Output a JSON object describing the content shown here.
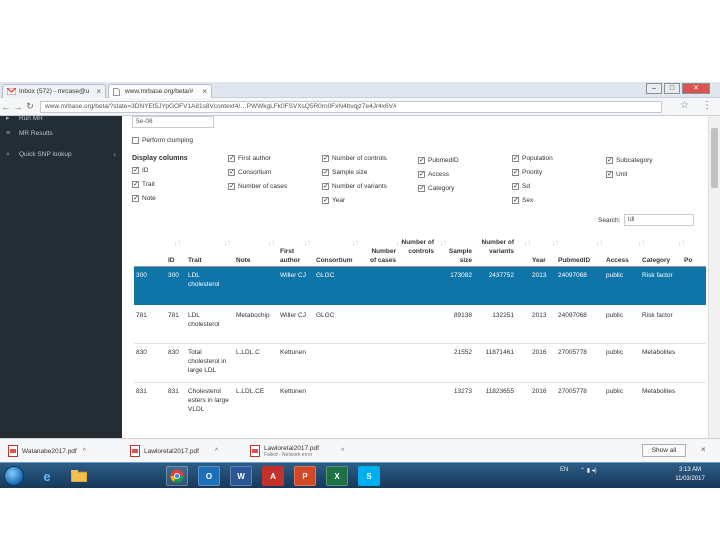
{
  "browser": {
    "tabs": [
      {
        "label": "Inbox (572) - mrcase@u"
      },
      {
        "label": "www.mrbase.org/beta/#"
      }
    ],
    "url": "www.mrbase.org/beta/?state=3DNYEt5JYpGOFV1A81s8Vcontext4/…PWWkgLFk0FSVXsQ5R0rn0FxN4bvqjz7e4Jr4x6V#"
  },
  "sidebar": {
    "items": [
      {
        "label": "Run MR",
        "icon": "play-icon"
      },
      {
        "label": "MR Results",
        "icon": "list-icon"
      },
      {
        "label": "Quick SNP lookup",
        "icon": "search-icon"
      }
    ]
  },
  "controls": {
    "pval_value": "5e-08",
    "clumping_label": "Perform clumping",
    "display_columns_label": "Display columns",
    "columns": [
      {
        "label": "ID",
        "checked": true
      },
      {
        "label": "Trait",
        "checked": true
      },
      {
        "label": "Note",
        "checked": true
      },
      {
        "label": "First author",
        "checked": true
      },
      {
        "label": "Consortium",
        "checked": true
      },
      {
        "label": "Number of cases",
        "checked": true
      },
      {
        "label": "Number of controls",
        "checked": true
      },
      {
        "label": "Sample size",
        "checked": true
      },
      {
        "label": "Number of variants",
        "checked": true
      },
      {
        "label": "Year",
        "checked": true
      },
      {
        "label": "PubmedID",
        "checked": true
      },
      {
        "label": "Access",
        "checked": true
      },
      {
        "label": "Category",
        "checked": true
      },
      {
        "label": "Population",
        "checked": true
      },
      {
        "label": "Priority",
        "checked": true
      },
      {
        "label": "Sd",
        "checked": true
      },
      {
        "label": "Sex",
        "checked": true
      },
      {
        "label": "Subcategory",
        "checked": true
      },
      {
        "label": "Unit",
        "checked": true
      }
    ],
    "search_label": "Search:",
    "search_value": "ldl"
  },
  "table": {
    "headers": [
      "ID",
      "Trait",
      "Note",
      "First author",
      "Consortium",
      "Number of cases",
      "Number of controls",
      "Sample size",
      "Number of variants",
      "Year",
      "PubmedID",
      "Access",
      "Category",
      "Po"
    ],
    "rows": [
      {
        "rownum": "300",
        "id": "300",
        "trait": "LDL cholesterol",
        "note": "",
        "author": "Willer CJ",
        "consortium": "GLGC",
        "cases": "",
        "controls": "",
        "size": "173082",
        "variants": "2437752",
        "year": "2013",
        "pubmed": "24097068",
        "access": "public",
        "category": "Risk factor",
        "selected": true
      },
      {
        "rownum": "781",
        "id": "781",
        "trait": "LDL cholesterol",
        "note": "Metabochip",
        "author": "Willer CJ",
        "consortium": "GLGC",
        "cases": "",
        "controls": "",
        "size": "89138",
        "variants": "132251",
        "year": "2013",
        "pubmed": "24097068",
        "access": "public",
        "category": "Risk factor",
        "selected": false
      },
      {
        "rownum": "830",
        "id": "830",
        "trait": "Total cholesterol in large LDL",
        "note": "L.LDL.C",
        "author": "Kettunen",
        "consortium": "",
        "cases": "",
        "controls": "",
        "size": "21552",
        "variants": "11871461",
        "year": "2016",
        "pubmed": "27005778",
        "access": "public",
        "category": "Metabolites",
        "selected": false
      },
      {
        "rownum": "831",
        "id": "831",
        "trait": "Cholesterol esters in large VLDL",
        "note": "L.LDL.CE",
        "author": "Kettunen",
        "consortium": "",
        "cases": "",
        "controls": "",
        "size": "13273",
        "variants": "11823655",
        "year": "2016",
        "pubmed": "27005778",
        "access": "public",
        "category": "Metabolites",
        "selected": false
      }
    ]
  },
  "downloads": {
    "items": [
      {
        "name": "Watanabe2017.pdf",
        "status": ""
      },
      {
        "name": "Lawloretal2017.pdf",
        "status": ""
      },
      {
        "name": "Lawloretal2017.pdf",
        "status": "Failed - Network error"
      }
    ],
    "show_all": "Show all"
  },
  "taskbar": {
    "language": "EN",
    "time": "3:13 AM",
    "date": "11/03/2017"
  },
  "colors": {
    "selected_row": "#0f74a8",
    "sidebar_bg": "#232d33"
  }
}
